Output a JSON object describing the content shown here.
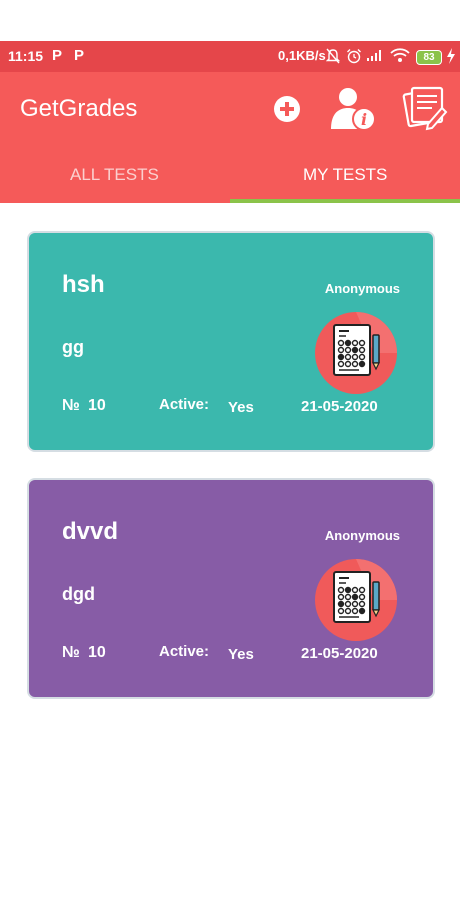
{
  "status": {
    "time": "11:15",
    "p1": "P",
    "p2": "P",
    "network": "0,1KB/s",
    "battery": "83"
  },
  "app": {
    "title": "GetGrades"
  },
  "tabs": [
    {
      "label": "ALL TESTS",
      "selected": false
    },
    {
      "label": "MY TESTS",
      "selected": true
    }
  ],
  "colors": {
    "primary": "#f55a59",
    "status_bar": "#e5464a",
    "tab_indicator": "#8bc34a",
    "card1": "#3bb8ad",
    "card2": "#875ca6"
  },
  "tests": [
    {
      "name": "hsh",
      "visibility": "Anonymous",
      "subject": "gg",
      "number_label": "№",
      "number": "10",
      "active_label": "Active:",
      "active": "Yes",
      "date": "21-05-2020",
      "icon": "answer-sheet-icon"
    },
    {
      "name": "dvvd",
      "visibility": "Anonymous",
      "subject": "dgd",
      "number_label": "№",
      "number": "10",
      "active_label": "Active:",
      "active": "Yes",
      "date": "21-05-2020",
      "icon": "answer-sheet-icon"
    }
  ]
}
